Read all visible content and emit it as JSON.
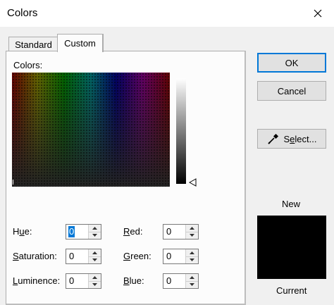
{
  "window": {
    "title": "Colors"
  },
  "tabs": [
    {
      "label": "Standard",
      "active": false
    },
    {
      "label": "Custom",
      "active": true
    }
  ],
  "custom": {
    "colors_label": "Colors:",
    "fields": {
      "hue": {
        "label_pre": "H",
        "label_ul": "u",
        "label_post": "e:",
        "value": "0"
      },
      "saturation": {
        "label_pre": "",
        "label_ul": "S",
        "label_post": "aturation:",
        "value": "0"
      },
      "luminence": {
        "label_pre": "",
        "label_ul": "L",
        "label_post": "uminence:",
        "value": "0"
      },
      "red": {
        "label_pre": "",
        "label_ul": "R",
        "label_post": "ed:",
        "value": "0"
      },
      "green": {
        "label_pre": "",
        "label_ul": "G",
        "label_post": "reen:",
        "value": "0"
      },
      "blue": {
        "label_pre": "",
        "label_ul": "B",
        "label_post": "lue:",
        "value": "0"
      }
    }
  },
  "buttons": {
    "ok": "OK",
    "cancel": "Cancel",
    "select_pre": "S",
    "select_ul": "e",
    "select_post": "lect..."
  },
  "preview": {
    "new_label": "New",
    "current_label": "Current",
    "new_color": "#000000",
    "current_color": "#000000"
  },
  "icons": {
    "close": "close-icon",
    "eyedropper": "eyedropper-icon",
    "luminance_pointer": "triangle-left-icon",
    "spin_up": "chevron-up-icon",
    "spin_down": "chevron-down-icon"
  },
  "colors": {
    "accent": "#0078d7",
    "dialog_bg": "#f0f0f0",
    "button_bg": "#e1e1e1"
  }
}
